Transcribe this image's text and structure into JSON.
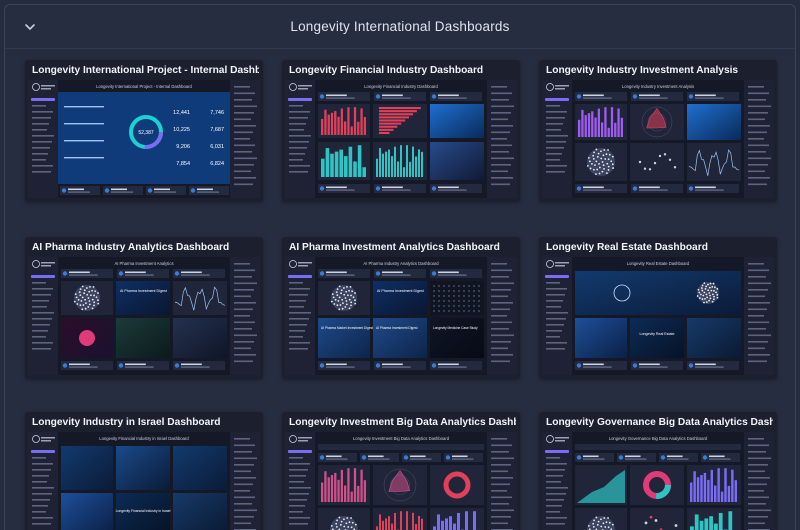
{
  "header": {
    "title": "Longevity International Dashboards",
    "collapse_icon": "chevron-down-icon"
  },
  "cards": [
    {
      "title": "Longevity International Project - Internal Dashboard",
      "thumb_label": "Longevity International Project - Internal Dashboard",
      "style": "kpi",
      "kpis": [
        "12,441",
        "7,746",
        "10,225",
        "7,687",
        "9,206",
        "6,031",
        "7,854",
        "6,824"
      ],
      "center": "52,387"
    },
    {
      "title": "Longevity Financial Industry Dashboard",
      "thumb_label": "Longevity Financial Industry Dashboard",
      "style": "bars"
    },
    {
      "title": "Longevity Industry Investment Analysis",
      "thumb_label": "Longevity Industry Investment Analysis",
      "style": "radar"
    },
    {
      "title": "AI Pharma Industry Analytics Dashboard",
      "thumb_label": "AI Pharma Investment Analytics",
      "style": "pharma",
      "tile_text": "AI Pharma Investment Digest"
    },
    {
      "title": "AI Pharma Investment Analytics Dashboard",
      "thumb_label": "AI Pharma Industry Analytics Dashboard",
      "style": "pharma2",
      "tile_text": "AI Pharma Investment Digest",
      "tiles": [
        "AI Pharma Market Investment Digest 2022",
        "Longevity Medicine Case Study"
      ]
    },
    {
      "title": "Longevity Real Estate Dashboard",
      "thumb_label": "Longevity Real Estate Dashboard",
      "style": "realestate",
      "tile_text": "Longevity Real Estate"
    },
    {
      "title": "Longevity Industry in Israel Dashboard",
      "thumb_label": "Longevity Financial Industry in Israel Dashboard",
      "style": "israel",
      "tile_text": "Longevity Financial Industry in Israel"
    },
    {
      "title": "Longevity Investment Big Data Analytics Dashboard",
      "thumb_label": "Longevity Investment Big Data Analytics Dashboard",
      "style": "bigdata"
    },
    {
      "title": "Longevity Governance Big Data Analytics Dashboard",
      "thumb_label": "Longevity Governance Big Data Analytics Dashboard",
      "style": "governance"
    }
  ],
  "colors": {
    "background": "#262c3f",
    "card": "#1b1f2e",
    "accent_purple": "#7b6cf6",
    "bar_red": "#e0405a",
    "teal": "#2ec4c4",
    "blue_panel": "#1f4a8a"
  }
}
